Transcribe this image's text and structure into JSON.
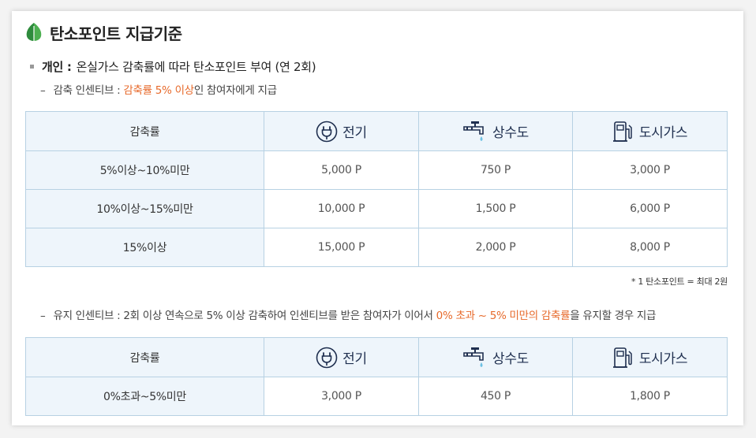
{
  "title": "탄소포인트 지급기준",
  "section": {
    "label": "개인 :",
    "text": "온실가스 감축률에 따라 탄소포인트 부여 (연 2회)"
  },
  "reduction": {
    "dash": "–",
    "prefix": "감축 인센티브 : ",
    "highlight": "감축률 5% 이상",
    "suffix": "인 참여자에게 지급"
  },
  "maintain": {
    "dash": "–",
    "prefix": "유지 인센티브 : 2회 이상 연속으로 5% 이상 감축하여 인센티브를 받은 참여자가 이어서 ",
    "highlight": "0% 초과 ~ 5% 미만의 감축률",
    "suffix": "을 유지할 경우 지급"
  },
  "headers": {
    "rate": "감축률",
    "electricity": "전기",
    "water": "상수도",
    "gas": "도시가스"
  },
  "table1": [
    {
      "rate": "5%이상~10%미만",
      "electricity": "5,000 P",
      "water": "750 P",
      "gas": "3,000 P"
    },
    {
      "rate": "10%이상~15%미만",
      "electricity": "10,000 P",
      "water": "1,500 P",
      "gas": "6,000 P"
    },
    {
      "rate": "15%이상",
      "electricity": "15,000 P",
      "water": "2,000 P",
      "gas": "8,000 P"
    }
  ],
  "table2": [
    {
      "rate": "0%초과~5%미만",
      "electricity": "3,000 P",
      "water": "450 P",
      "gas": "1,800 P"
    }
  ],
  "note": "* 1 탄소포인트 = 최대 2원",
  "colors": {
    "accent": "#e76a2b",
    "header_bg": "#eef5fb",
    "border": "#b7d1e3",
    "leaf": "#4caf50"
  },
  "icons": {
    "title": "leaf-icon",
    "electricity": "plug-icon",
    "water": "faucet-icon",
    "gas": "gas-pump-icon"
  }
}
